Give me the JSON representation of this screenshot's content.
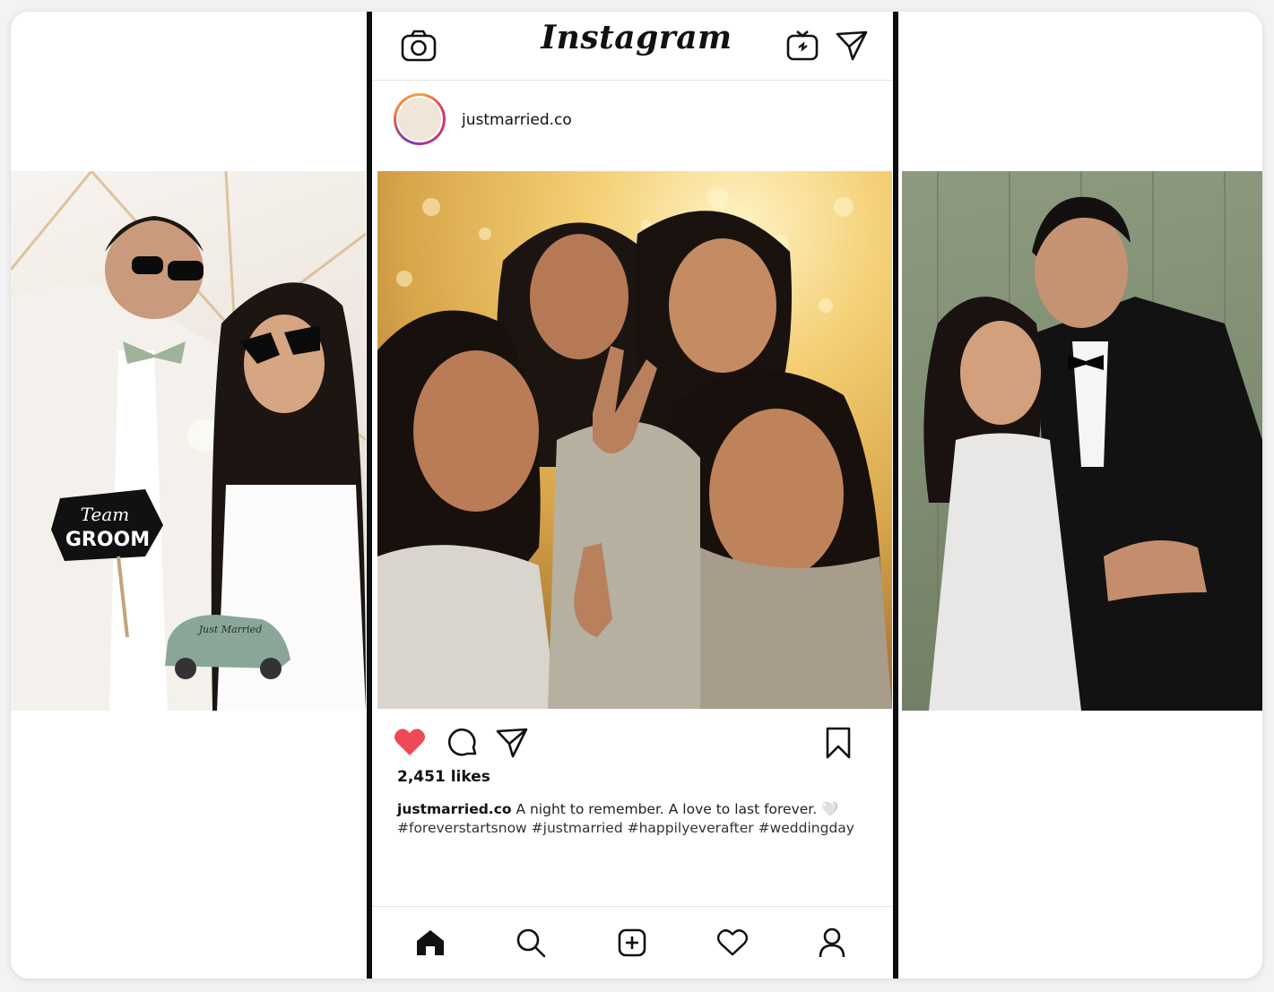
{
  "app": {
    "title": "Instagram"
  },
  "post": {
    "username": "justmarried.co",
    "likes": "2,451 likes",
    "caption_user": "justmarried.co",
    "caption_text": " A night to remember. A love to last forever. 🤍",
    "hashtags": "#foreverstartsnow #justmarried #happilyeverafter #weddingday"
  },
  "props": {
    "sign_team": "Team",
    "sign_groom": "GROOM",
    "car_sign": "Just Married"
  },
  "icons": {
    "top_left": "camera-icon",
    "top_right_1": "igtv-icon",
    "top_right_2": "direct-message-icon",
    "actions": [
      "heart-filled-icon",
      "comment-icon",
      "share-icon",
      "bookmark-icon"
    ],
    "nav": [
      "home-icon",
      "search-icon",
      "add-post-icon",
      "activity-heart-icon",
      "profile-icon"
    ]
  },
  "colors": {
    "like_red": "#ed4956",
    "text": "#111111"
  }
}
